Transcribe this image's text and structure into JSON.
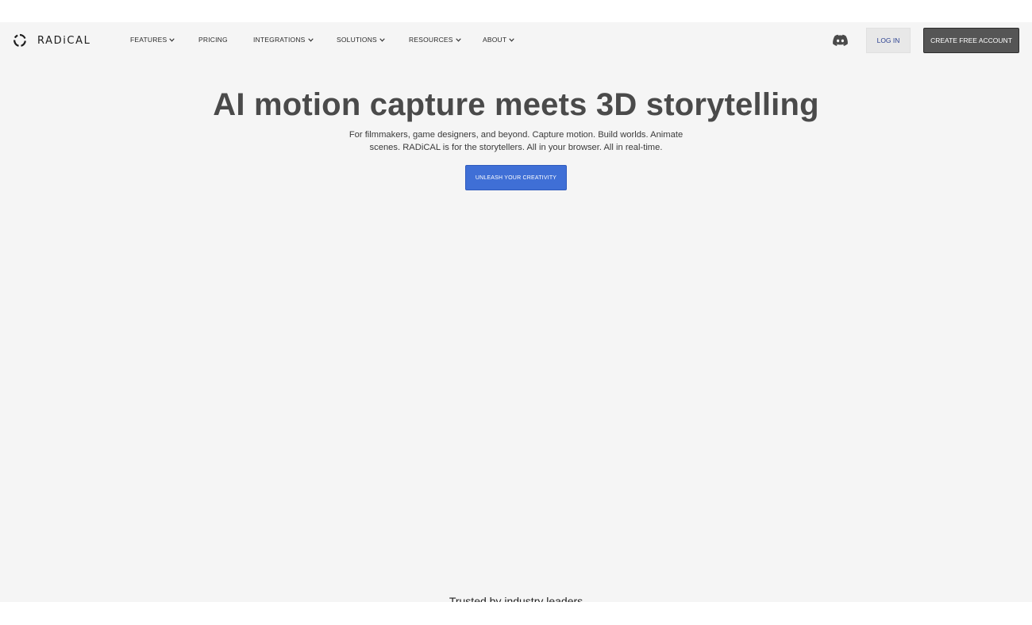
{
  "brand": {
    "logo_icon": "radical-logo-mark",
    "name": "RADiCAL"
  },
  "nav": {
    "items": [
      {
        "label": "FEATURES",
        "has_dropdown": true
      },
      {
        "label": "PRICING",
        "has_dropdown": false
      },
      {
        "label": "INTEGRATIONS",
        "has_dropdown": true
      },
      {
        "label": "SOLUTIONS",
        "has_dropdown": true
      },
      {
        "label": "RESOURCES",
        "has_dropdown": true
      },
      {
        "label": "ABOUT",
        "has_dropdown": true
      }
    ],
    "discord_icon": "discord-icon",
    "login_label": "LOG IN",
    "create_account_label": "CREATE FREE ACCOUNT"
  },
  "hero": {
    "title": "AI motion capture meets 3D storytelling",
    "subtitle": "For filmmakers, game designers, and beyond. Capture motion. Build worlds. Animate scenes. RADiCAL is for the storytellers. All in your browser. All in real-time.",
    "cta_label": "UNLEASH YOUR CREATIVITY"
  },
  "trusted": {
    "heading": "Trusted by industry leaders"
  },
  "colors": {
    "page_bg": "#f5f5f5",
    "cta_blue": "#3f6fd6",
    "dark_button": "#555555",
    "login_text": "#2a3f8f"
  }
}
